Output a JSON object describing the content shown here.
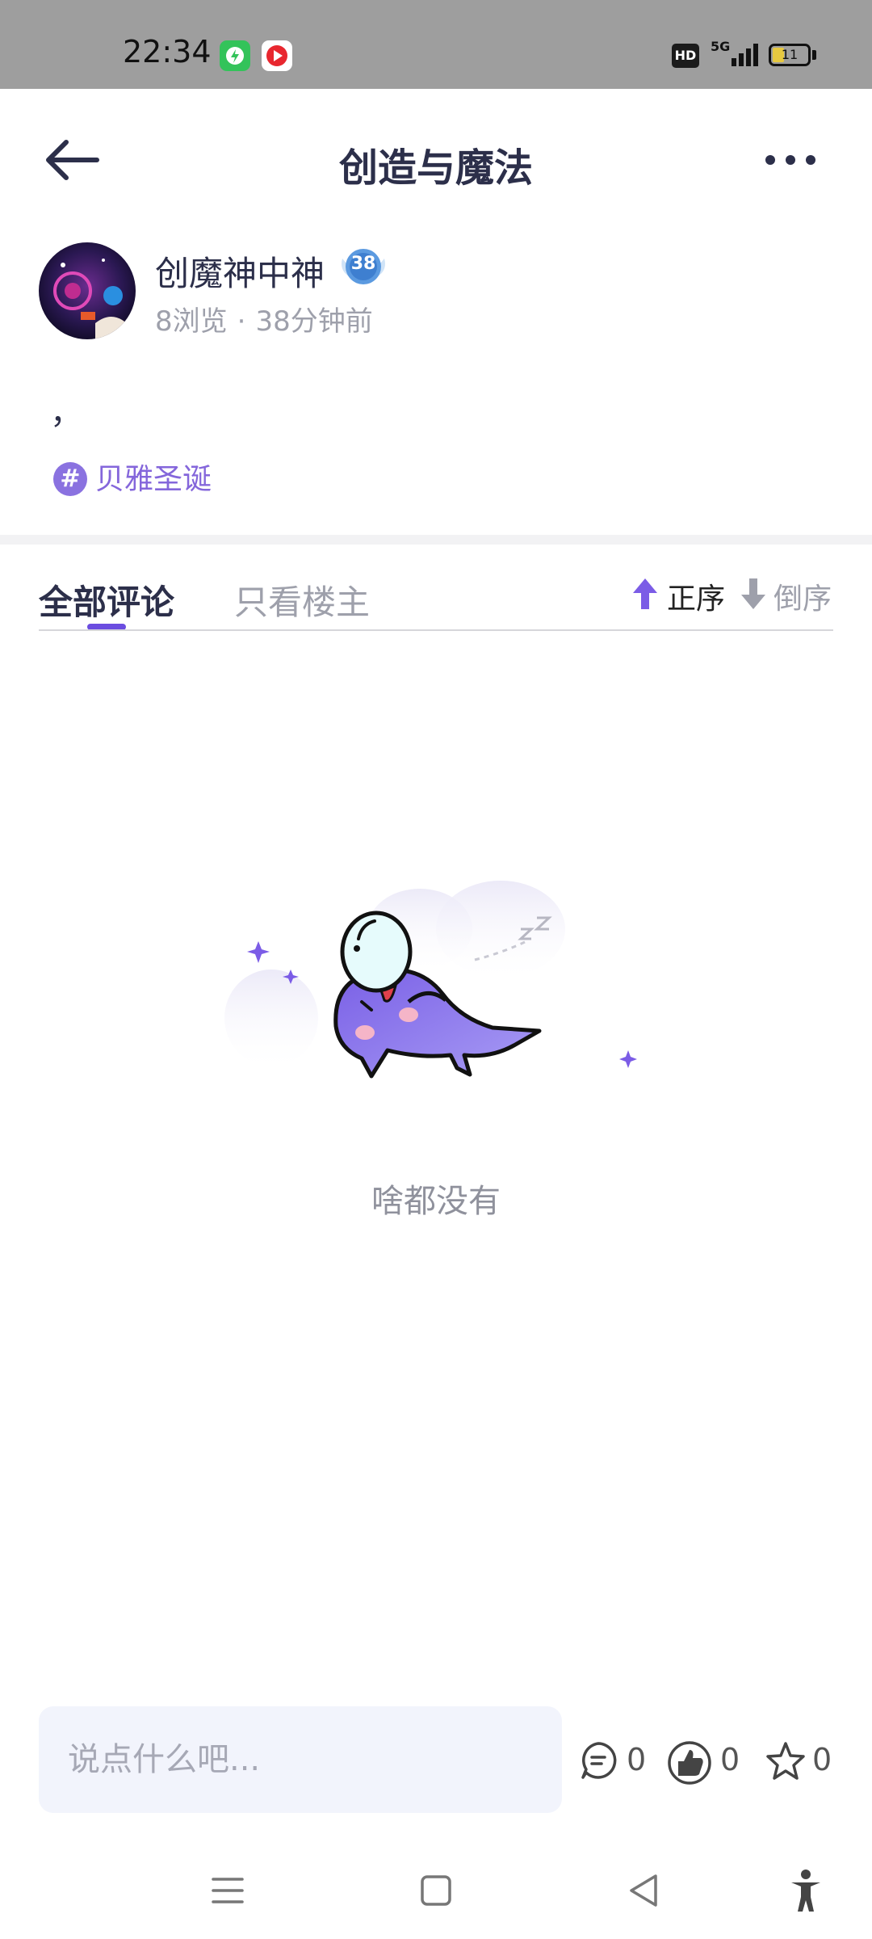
{
  "status_bar": {
    "time": "22:34",
    "hd_label": "HD",
    "network_label": "5G",
    "battery_level": "11"
  },
  "header": {
    "title": "创造与魔法",
    "back_icon": "arrow-left-icon",
    "more_icon": "more-dots-icon"
  },
  "post": {
    "author": "创魔神中神",
    "level": "38",
    "views": "8浏览",
    "separator": "·",
    "time_ago": "38分钟前",
    "content": "，",
    "topic_hash": "#",
    "topic": "贝雅圣诞"
  },
  "comments": {
    "tabs": [
      {
        "label": "全部评论",
        "active": true
      },
      {
        "label": "只看楼主",
        "active": false
      }
    ],
    "sort_asc": "正序",
    "sort_desc": "倒序",
    "empty_text": "啥都没有"
  },
  "bottom_bar": {
    "input_placeholder": "说点什么吧...",
    "comment_count": "0",
    "like_count": "0",
    "favorite_count": "0"
  },
  "colors": {
    "accent": "#6b4de0",
    "tag": "#8466db",
    "title": "#2c2f4a",
    "muted": "#9ea0ab"
  }
}
